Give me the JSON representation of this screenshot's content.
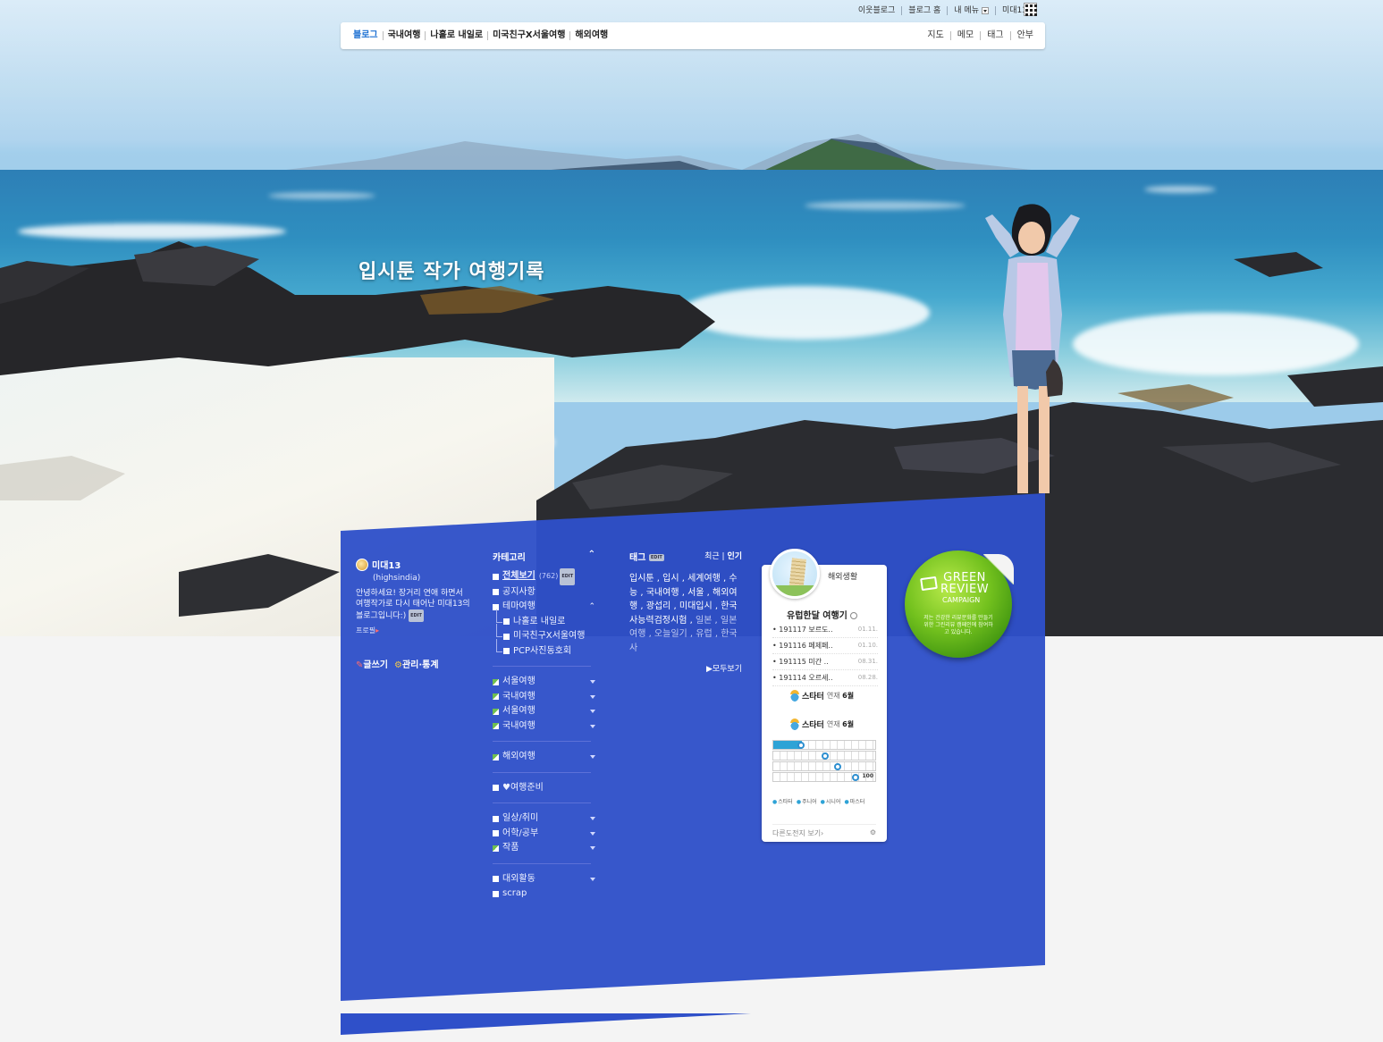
{
  "util": {
    "items": [
      "이웃블로그",
      "블로그 홈",
      "내 메뉴",
      "미대13"
    ]
  },
  "nav": {
    "left": [
      "블로그",
      "국내여행",
      "나홀로 내일로",
      "미국친구X서울여행",
      "해외여행"
    ],
    "right": [
      "지도",
      "메모",
      "태그",
      "안부"
    ]
  },
  "hero": {
    "title": "입시툰 작가 여행기록"
  },
  "profile": {
    "nickname": "미대13",
    "user_id": "(highsindia)",
    "intro": "안녕하세요! 장거리 연애 하면서 여행작가로 다시 태어난 미대13의 블로그입니다:)",
    "edit": "EDIT",
    "profile_link": "프로필",
    "write": "글쓰기",
    "manage": "관리·통계"
  },
  "category": {
    "title": "카테고리",
    "all_label": "전체보기",
    "all_count": "(762)",
    "edit": "EDIT",
    "groups": [
      [
        {
          "label": "공지사항",
          "icon": "plain",
          "arrow": false,
          "sub": false
        },
        {
          "label": "테마여행",
          "icon": "plain",
          "arrow": "up",
          "sub": false
        },
        {
          "label": "나홀로 내일로",
          "icon": "plain",
          "arrow": false,
          "sub": true
        },
        {
          "label": "미국친구X서울여행",
          "icon": "plain",
          "arrow": false,
          "sub": true
        },
        {
          "label": "PCP사진동호회",
          "icon": "plain",
          "arrow": false,
          "sub": true
        }
      ],
      [
        {
          "label": "서울여행",
          "icon": "img",
          "arrow": "down",
          "sub": false
        },
        {
          "label": "국내여행",
          "icon": "img",
          "arrow": "down",
          "sub": false
        },
        {
          "label": "서울여행",
          "icon": "img",
          "arrow": "down",
          "sub": false
        },
        {
          "label": "국내여행",
          "icon": "img",
          "arrow": "down",
          "sub": false
        }
      ],
      [
        {
          "label": "해외여행",
          "icon": "img",
          "arrow": "down",
          "sub": false
        }
      ],
      [
        {
          "label": "♥여행준비",
          "icon": "plain",
          "arrow": false,
          "sub": false
        }
      ],
      [
        {
          "label": "일상/취미",
          "icon": "plain",
          "arrow": "down",
          "sub": false
        },
        {
          "label": "어학/공부",
          "icon": "plain",
          "arrow": "down",
          "sub": false
        },
        {
          "label": "작품",
          "icon": "img",
          "arrow": "down",
          "sub": false
        }
      ],
      [
        {
          "label": "대외활동",
          "icon": "plain",
          "arrow": "down",
          "sub": false
        },
        {
          "label": "scrap",
          "icon": "plain",
          "arrow": false,
          "sub": false
        }
      ]
    ]
  },
  "tags": {
    "title": "태그",
    "edit": "EDIT",
    "recent": "최근",
    "popular": "인기",
    "text": "입시툰 , 입시 , 세계여행 , 수능 , 국내여행 , 서울 , 해외여행 , 광섭리 , 미대입시 , 한국사능력검정시험 ,",
    "faint_text": "일본 , 일본여행 , 오늘일기 , 유럽 , 한국사",
    "more": "▶모두보기"
  },
  "widget": {
    "title": "해외생활",
    "subtitle": "유럽한달 여행기",
    "posts": [
      {
        "title": "191117 보르도..",
        "date": "01.11."
      },
      {
        "title": "191116 페제페..",
        "date": "01.10."
      },
      {
        "title": "191115 미간 ..",
        "date": "08.31."
      },
      {
        "title": "191114 오르세..",
        "date": "08.28."
      }
    ],
    "level_name": "스타터",
    "level_prefix": "연재",
    "level_months": "6월",
    "levels": [
      {
        "fill": 0.28
      },
      {
        "fill": 0.52
      },
      {
        "fill": 0.64
      },
      {
        "fill": 0.82
      }
    ],
    "max_label": "100",
    "legend": [
      "스타터",
      "주니어",
      "시니어",
      "마스터"
    ],
    "footer": "다른도전지 보기›"
  },
  "badge": {
    "line1": "GREEN",
    "line2": "REVIEW",
    "line3": "CAMPAIGN",
    "desc": "저는 건강한 리뷰문화를 만들기 위한 그린리뷰 캠페인에 참여하고 있습니다."
  },
  "colors": {
    "panel_blue": "#2f50c9",
    "nav_active": "#1b6fd2",
    "badge_green": "#5faf18"
  }
}
